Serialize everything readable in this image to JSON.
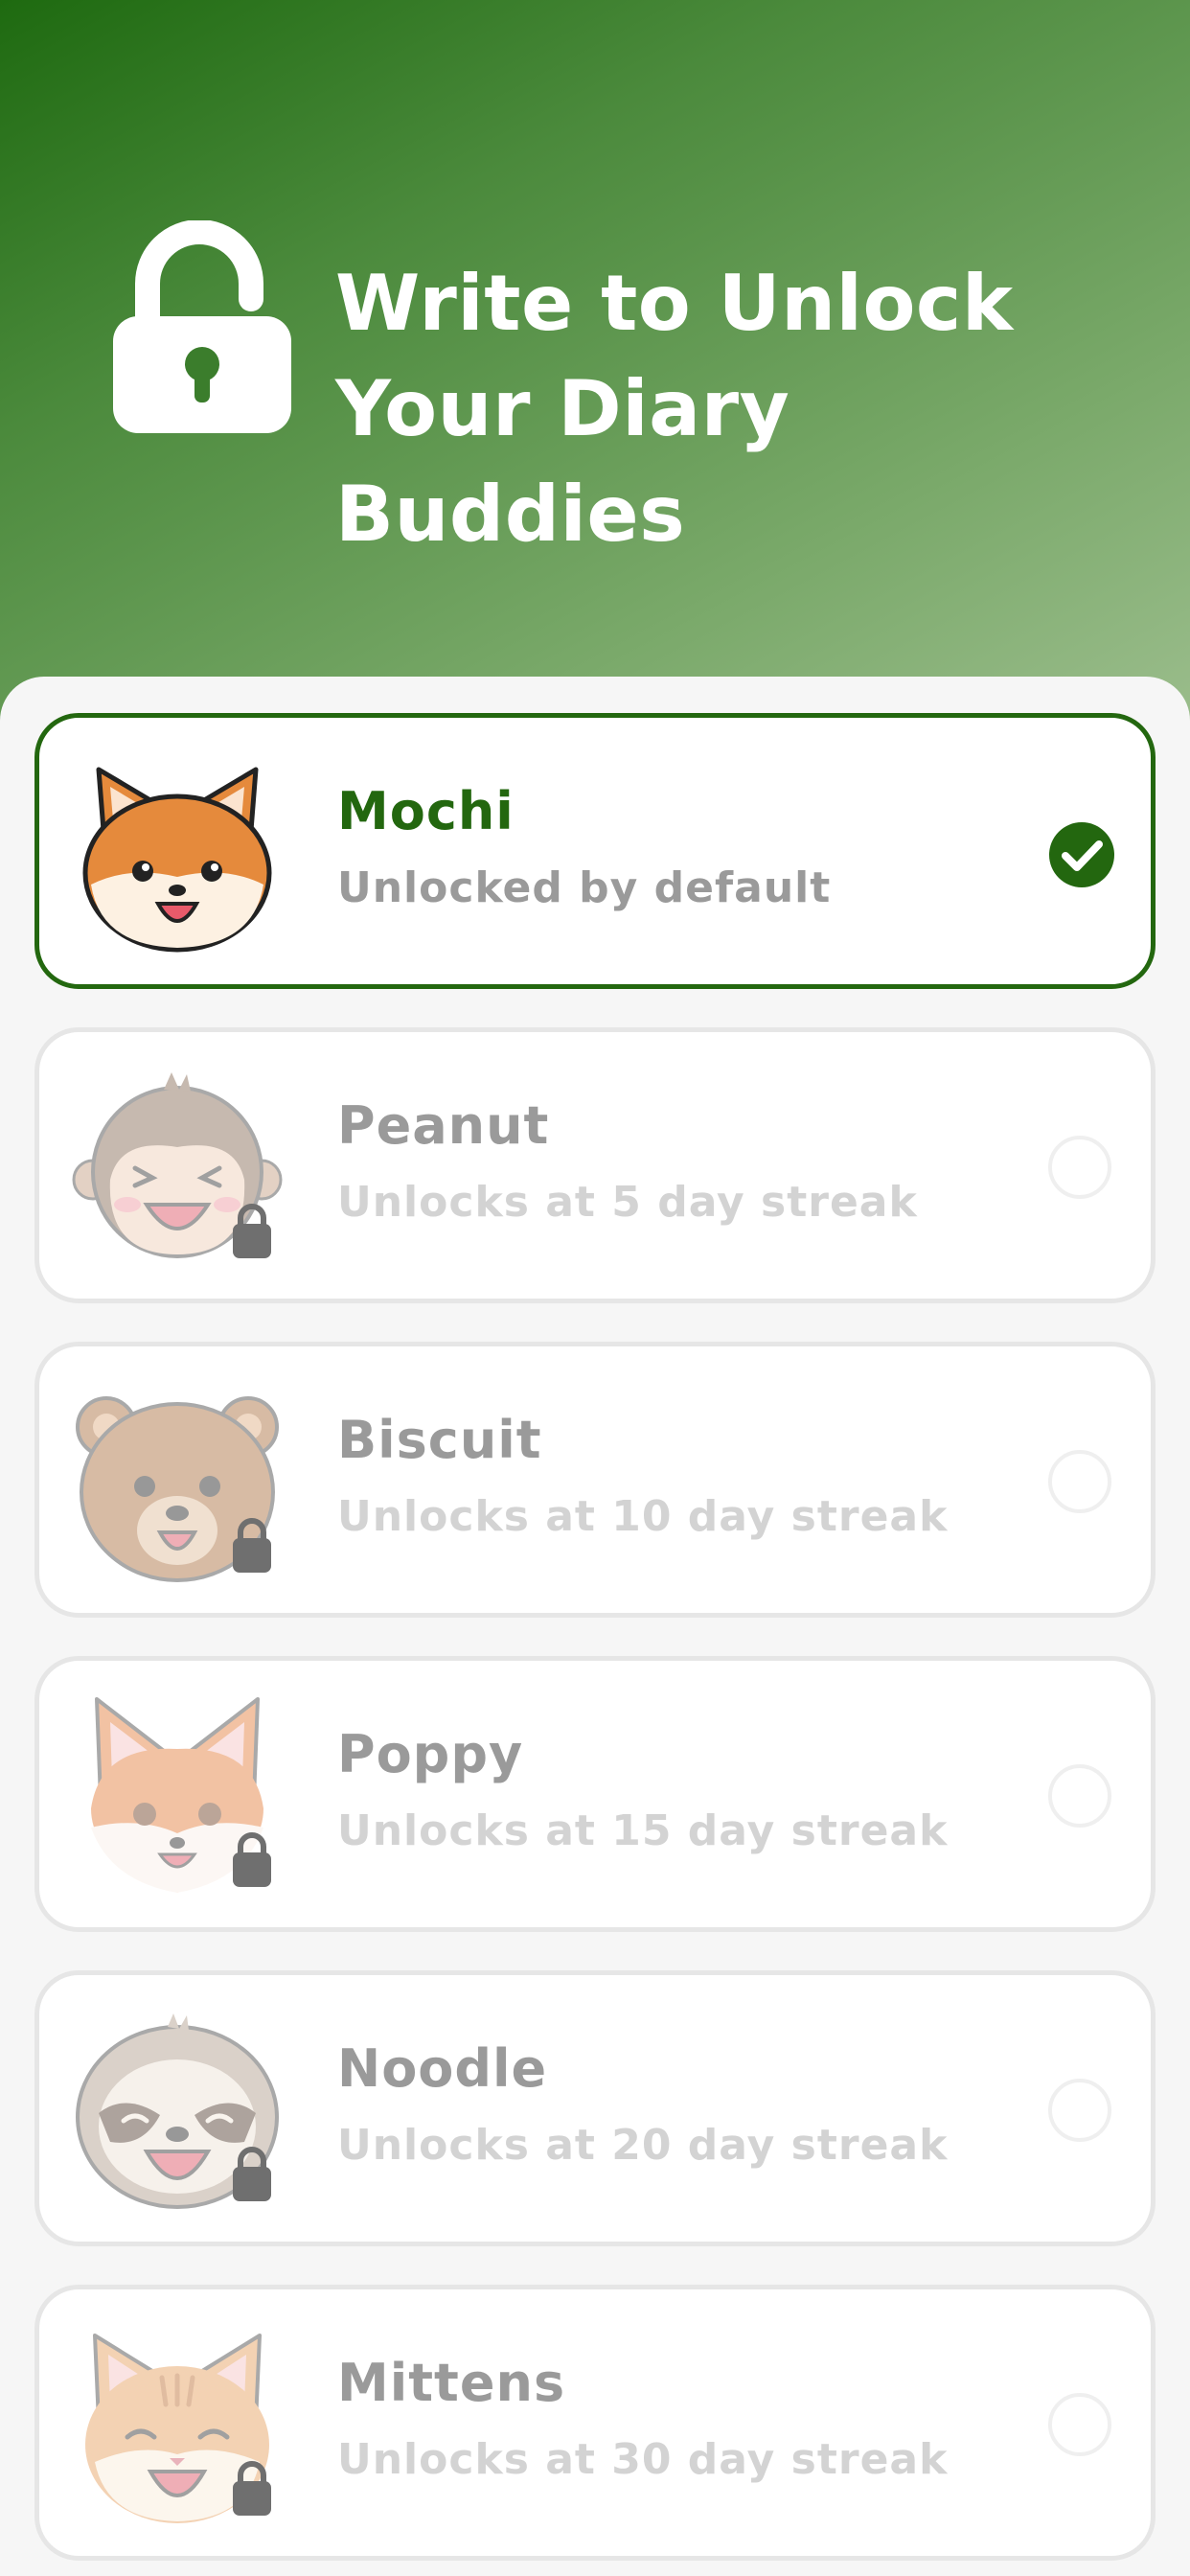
{
  "header": {
    "title_line1": "Write to Unlock",
    "title_line2": "Your Diary Buddies",
    "icon": "unlocked-padlock-icon",
    "gradient_start": "#1e6a10",
    "gradient_end": "#9bbd8c"
  },
  "buddies": [
    {
      "name": "Mochi",
      "subtitle": "Unlocked by default",
      "animal": "shiba-inu",
      "selected": true,
      "locked": false
    },
    {
      "name": "Peanut",
      "subtitle": "Unlocks at 5 day streak",
      "animal": "monkey",
      "selected": false,
      "locked": true
    },
    {
      "name": "Biscuit",
      "subtitle": "Unlocks at 10 day streak",
      "animal": "bear",
      "selected": false,
      "locked": true
    },
    {
      "name": "Poppy",
      "subtitle": "Unlocks at 15 day streak",
      "animal": "fox",
      "selected": false,
      "locked": true
    },
    {
      "name": "Noodle",
      "subtitle": "Unlocks at 20 day streak",
      "animal": "sloth",
      "selected": false,
      "locked": true
    },
    {
      "name": "Mittens",
      "subtitle": "Unlocks at 30 day streak",
      "animal": "cat",
      "selected": false,
      "locked": true
    }
  ],
  "colors": {
    "accent": "#23670f",
    "card_border": "#e6e6e6",
    "locked_name": "#9a9a9a",
    "locked_subtitle": "#d3d3d3"
  }
}
